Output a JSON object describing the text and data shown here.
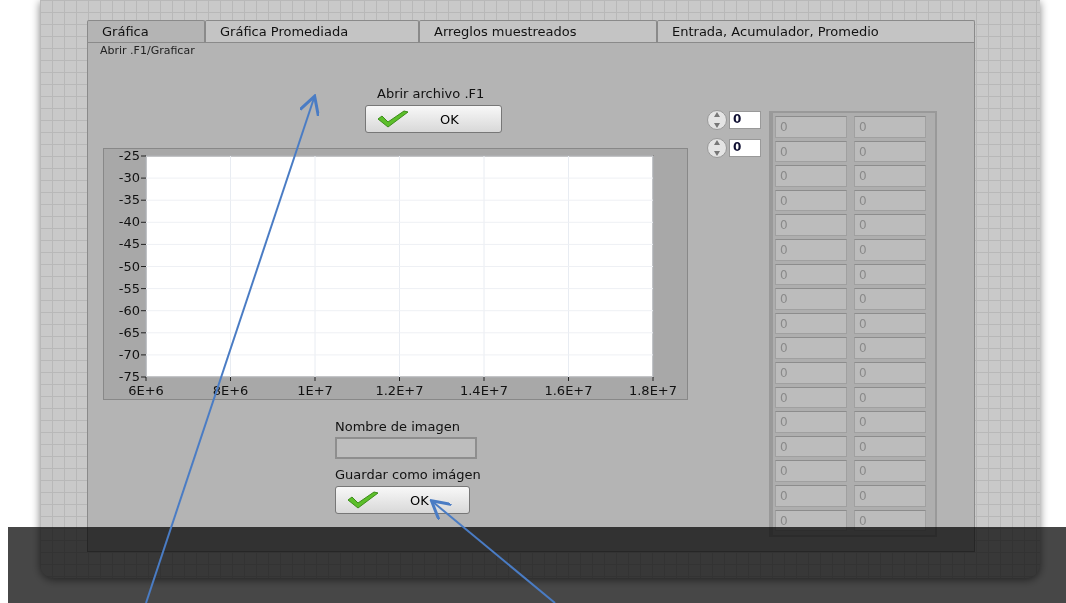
{
  "tabs": [
    {
      "label": "Gráfica",
      "selected": true
    },
    {
      "label": "Gráfica Promediada",
      "selected": false
    },
    {
      "label": "Arreglos muestreados",
      "selected": false
    },
    {
      "label": "Entrada, Acumulador, Promedio",
      "selected": false
    }
  ],
  "page_label": "Abrir .F1/Graficar",
  "open_file": {
    "label": "Abrir archivo .F1",
    "button": "OK"
  },
  "chart": {
    "chart_data": {
      "type": "line",
      "grid": true,
      "xlim": [
        6000000,
        18000000
      ],
      "ylim": [
        -75,
        -25
      ],
      "xticks": [
        {
          "value": 6000000,
          "label": "6E+6"
        },
        {
          "value": 8000000,
          "label": "8E+6"
        },
        {
          "value": 10000000,
          "label": "1E+7"
        },
        {
          "value": 12000000,
          "label": "1.2E+7"
        },
        {
          "value": 14000000,
          "label": "1.4E+7"
        },
        {
          "value": 16000000,
          "label": "1.6E+7"
        },
        {
          "value": 18000000,
          "label": "1.8E+7"
        }
      ],
      "yticks": [
        -25,
        -30,
        -35,
        -40,
        -45,
        -50,
        -55,
        -60,
        -65,
        -70,
        -75
      ]
    }
  },
  "image_name": {
    "label": "Nombre de imagen"
  },
  "save_image": {
    "label": "Guardar como imágen",
    "button": "OK"
  },
  "indices": [
    "0",
    "0"
  ],
  "array": {
    "rows": [
      [
        "0",
        "0"
      ],
      [
        "0",
        "0"
      ],
      [
        "0",
        "0"
      ],
      [
        "0",
        "0"
      ],
      [
        "0",
        "0"
      ],
      [
        "0",
        "0"
      ],
      [
        "0",
        "0"
      ],
      [
        "0",
        "0"
      ],
      [
        "0",
        "0"
      ],
      [
        "0",
        "0"
      ],
      [
        "0",
        "0"
      ],
      [
        "0",
        "0"
      ],
      [
        "0",
        "0"
      ],
      [
        "0",
        "0"
      ],
      [
        "0",
        "0"
      ],
      [
        "0",
        "0"
      ],
      [
        "0",
        "0"
      ]
    ]
  }
}
